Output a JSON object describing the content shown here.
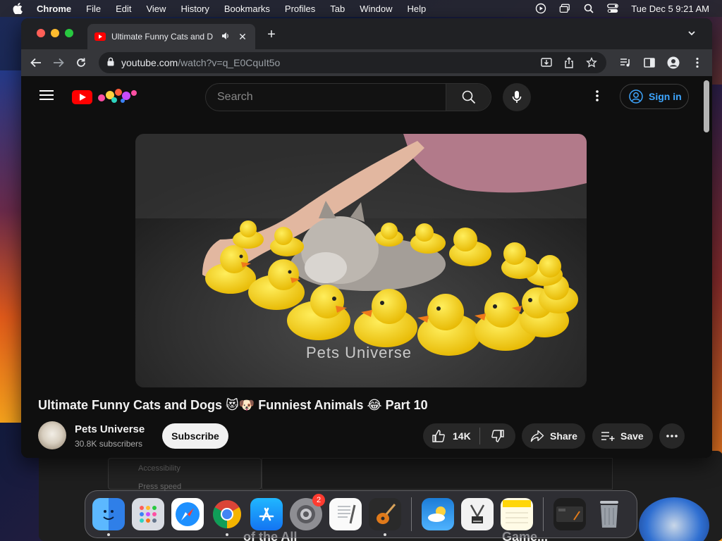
{
  "menubar": {
    "app": "Chrome",
    "items": [
      "File",
      "Edit",
      "View",
      "History",
      "Bookmarks",
      "Profiles",
      "Tab",
      "Window",
      "Help"
    ],
    "clock": "Tue Dec 5  9:21 AM"
  },
  "browser": {
    "tab_title": "Ultimate Funny Cats and D",
    "url_host": "youtube.com",
    "url_path": "/watch?v=q_E0CquIt5o"
  },
  "youtube": {
    "search_placeholder": "Search",
    "signin_label": "Sign in",
    "video_watermark": "Pets Universe",
    "video_title": "Ultimate Funny Cats and Dogs 😻🐶 Funniest Animals 😂 Part 10",
    "channel_name": "Pets Universe",
    "channel_subs": "30.8K subscribers",
    "subscribe_label": "Subscribe",
    "likes": "14K",
    "share_label": "Share",
    "save_label": "Save"
  },
  "background": {
    "panel_lines": [
      "Accessibility",
      "Press speed"
    ],
    "text_left": "of the All",
    "text_right": "Game..."
  },
  "dock": {
    "apps": [
      "Finder",
      "Launchpad",
      "Safari",
      "Chrome",
      "App Store",
      "System Settings",
      "TextEdit",
      "GarageBand",
      "Weather",
      "Xcode Instruments",
      "Notes",
      "Screenshot",
      "Trash"
    ],
    "system_settings_badge": "2"
  },
  "colors": {
    "accent_blue": "#3ea6ff",
    "youtube_red": "#ff0000",
    "page_bg": "#0f0f0f"
  }
}
